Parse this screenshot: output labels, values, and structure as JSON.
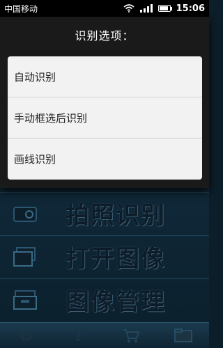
{
  "status_bar": {
    "carrier": "中国移动",
    "time": "15:06",
    "battery_level": 0.8
  },
  "dialog": {
    "title": "识别选项：",
    "options": [
      {
        "label": "自动识别"
      },
      {
        "label": "手动框选后识别"
      },
      {
        "label": "画线识别"
      }
    ]
  },
  "main_menu": {
    "items": [
      {
        "label": "拍照识别",
        "icon": "camera-icon"
      },
      {
        "label": "打开图像",
        "icon": "open-image-icon"
      },
      {
        "label": "图像管理",
        "icon": "image-manage-icon"
      }
    ]
  },
  "toolbar": {
    "items": [
      {
        "icon": "settings-icon"
      },
      {
        "icon": "help-icon"
      },
      {
        "icon": "cart-icon"
      },
      {
        "icon": "folder-icon"
      }
    ]
  },
  "colors": {
    "dialog_bg": "#1a1a1a",
    "options_bg": "#f2f2f2",
    "app_bg": "#0c1e29"
  }
}
